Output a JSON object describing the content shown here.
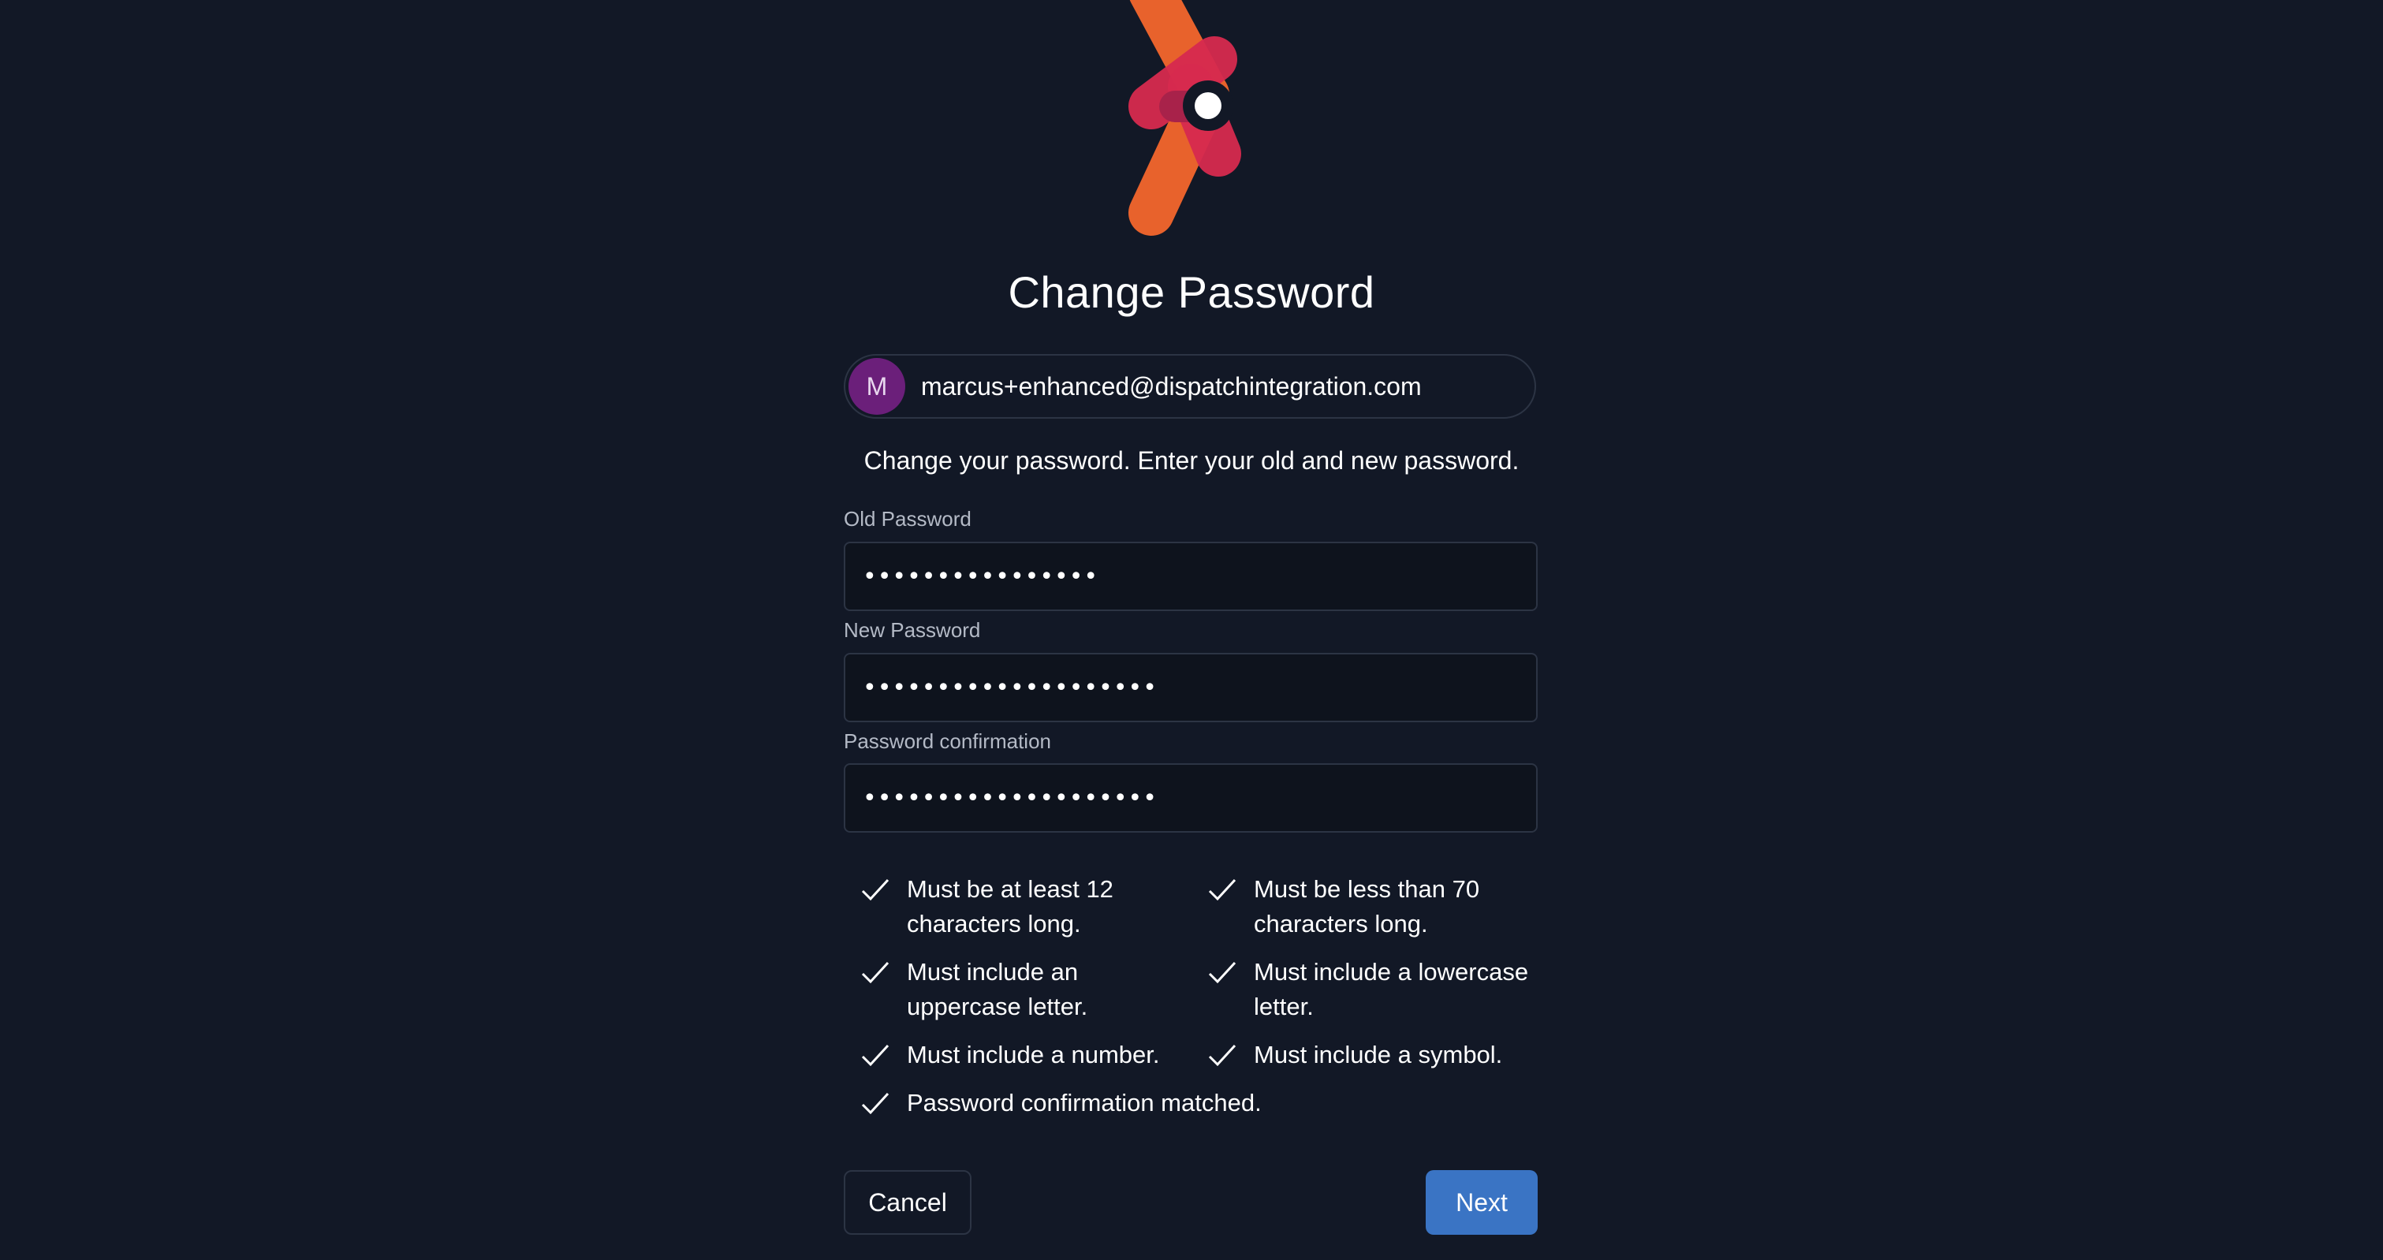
{
  "page": {
    "title": "Change Password",
    "subtitle": "Change your password. Enter your old and new password."
  },
  "account": {
    "avatar_letter": "M",
    "email": "marcus+enhanced@dispatchintegration.com",
    "avatar_color": "#6b1f7a"
  },
  "fields": {
    "old_password": {
      "label": "Old Password",
      "value": "••••••••••••••••"
    },
    "new_password": {
      "label": "New Password",
      "value": "••••••••••••••••••••"
    },
    "confirm_password": {
      "label": "Password confirmation",
      "value": "••••••••••••••••••••"
    }
  },
  "requirements": [
    {
      "text": "Must be at least 12 characters long.",
      "met": true
    },
    {
      "text": "Must be less than 70 characters long.",
      "met": true
    },
    {
      "text": "Must include an uppercase letter.",
      "met": true
    },
    {
      "text": "Must include a lowercase letter.",
      "met": true
    },
    {
      "text": "Must include a number.",
      "met": true
    },
    {
      "text": "Must include a symbol.",
      "met": true
    },
    {
      "text": "Password confirmation matched.",
      "met": true
    }
  ],
  "buttons": {
    "cancel": "Cancel",
    "next": "Next"
  },
  "colors": {
    "background": "#121826",
    "accent": "#3a74c4",
    "logo_orange": "#e8622c",
    "logo_pink": "#d72a4f"
  },
  "icons": {
    "logo": "dispatch-logo-icon",
    "check": "checkmark-icon"
  }
}
